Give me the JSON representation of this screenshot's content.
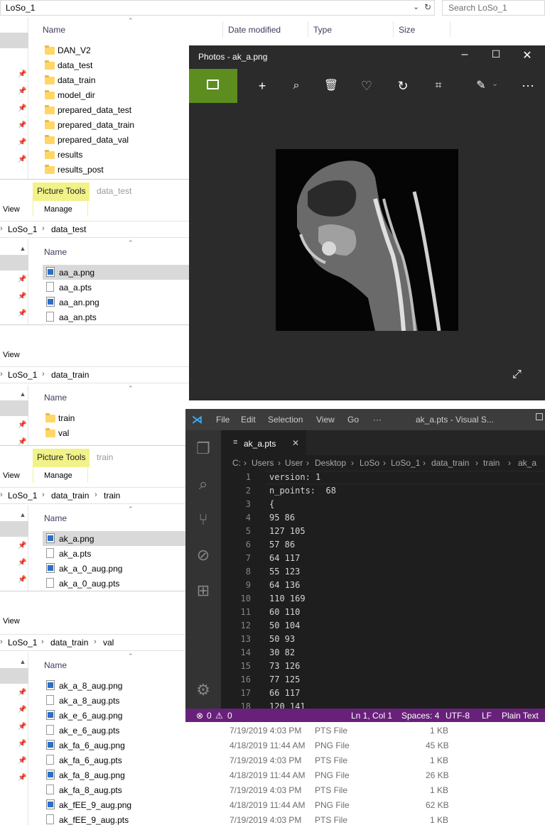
{
  "top_explorer": {
    "address": "LoSo_1",
    "search_placeholder": "Search LoSo_1",
    "columns": [
      "Name",
      "Date modified",
      "Type",
      "Size"
    ],
    "folders": [
      "DAN_V2",
      "data_test",
      "data_train",
      "model_dir",
      "prepared_data_test",
      "prepared_data_train",
      "prepared_data_val",
      "results",
      "results_post"
    ]
  },
  "explorer_data_test": {
    "picture_tools": "Picture Tools",
    "context_name": "data_test",
    "view_tab": "View",
    "manage_tab": "Manage",
    "breadcrumb": [
      "LoSo_1",
      "data_test"
    ],
    "column": "Name",
    "files": [
      "aa_a.png",
      "aa_a.pts",
      "aa_an.png",
      "aa_an.pts"
    ]
  },
  "explorer_data_train": {
    "view_tab": "View",
    "breadcrumb": [
      "LoSo_1",
      "data_train"
    ],
    "column": "Name",
    "folders": [
      "train",
      "val"
    ]
  },
  "explorer_train": {
    "picture_tools": "Picture Tools",
    "context_name": "train",
    "view_tab": "View",
    "manage_tab": "Manage",
    "breadcrumb": [
      "LoSo_1",
      "data_train",
      "train"
    ],
    "column": "Name",
    "files": [
      "ak_a.png",
      "ak_a.pts",
      "ak_a_0_aug.png",
      "ak_a_0_aug.pts"
    ]
  },
  "explorer_val": {
    "view_tab": "View",
    "breadcrumb": [
      "LoSo_1",
      "data_train",
      "val"
    ],
    "column": "Name",
    "files": [
      {
        "name": "ak_a_8_aug.png",
        "date": "",
        "type": "",
        "size": ""
      },
      {
        "name": "ak_a_8_aug.pts",
        "date": "",
        "type": "",
        "size": ""
      },
      {
        "name": "ak_e_6_aug.png",
        "date": "",
        "type": "",
        "size": ""
      },
      {
        "name": "ak_e_6_aug.pts",
        "date": "7/19/2019 4:03 PM",
        "type": "PTS File",
        "size": "1 KB"
      },
      {
        "name": "ak_fa_6_aug.png",
        "date": "4/18/2019 11:44 AM",
        "type": "PNG File",
        "size": "45 KB"
      },
      {
        "name": "ak_fa_6_aug.pts",
        "date": "7/19/2019 4:03 PM",
        "type": "PTS File",
        "size": "1 KB"
      },
      {
        "name": "ak_fa_8_aug.png",
        "date": "4/18/2019 11:44 AM",
        "type": "PNG File",
        "size": "26 KB"
      },
      {
        "name": "ak_fa_8_aug.pts",
        "date": "7/19/2019 4:03 PM",
        "type": "PTS File",
        "size": "1 KB"
      },
      {
        "name": "ak_fEE_9_aug.png",
        "date": "4/18/2019 11:44 AM",
        "type": "PNG File",
        "size": "62 KB"
      },
      {
        "name": "ak_fEE_9_aug.pts",
        "date": "7/19/2019 4:03 PM",
        "type": "PTS File",
        "size": "1 KB"
      }
    ]
  },
  "photos": {
    "title": "Photos - ak_a.png",
    "toolbar_icons": [
      "view-icon",
      "add-icon",
      "zoom-icon",
      "delete-icon",
      "favorite-icon",
      "rotate-icon",
      "crop-icon",
      "edit-icon",
      "more-icon"
    ]
  },
  "vscode": {
    "menu": [
      "File",
      "Edit",
      "Selection",
      "View",
      "Go",
      "···"
    ],
    "window_title": "ak_a.pts - Visual S...",
    "tab": "ak_a.pts",
    "breadcrumb": [
      "C:",
      "Users",
      "User",
      "Desktop",
      "LoSo",
      "LoSo_1",
      "data_train",
      "train",
      "ak_a"
    ],
    "lines": [
      {
        "n": "1",
        "text": "version: 1"
      },
      {
        "n": "2",
        "text": "n_points:  68"
      },
      {
        "n": "3",
        "text": "{"
      },
      {
        "n": "4",
        "text": "95 86"
      },
      {
        "n": "5",
        "text": "127 105"
      },
      {
        "n": "6",
        "text": "57 86"
      },
      {
        "n": "7",
        "text": "64 117"
      },
      {
        "n": "8",
        "text": "55 123"
      },
      {
        "n": "9",
        "text": "64 136"
      },
      {
        "n": "10",
        "text": "110 169"
      },
      {
        "n": "11",
        "text": "60 110"
      },
      {
        "n": "12",
        "text": "50 104"
      },
      {
        "n": "13",
        "text": "50 93"
      },
      {
        "n": "14",
        "text": "30 82"
      },
      {
        "n": "15",
        "text": "73 126"
      },
      {
        "n": "16",
        "text": "77 125"
      },
      {
        "n": "17",
        "text": "66 117"
      },
      {
        "n": "18",
        "text": "120 141"
      }
    ],
    "status": {
      "errors": "0",
      "warnings": "0",
      "position": "Ln 1, Col 1",
      "spaces": "Spaces: 4",
      "encoding": "UTF-8",
      "eol": "LF",
      "language": "Plain Text"
    }
  }
}
